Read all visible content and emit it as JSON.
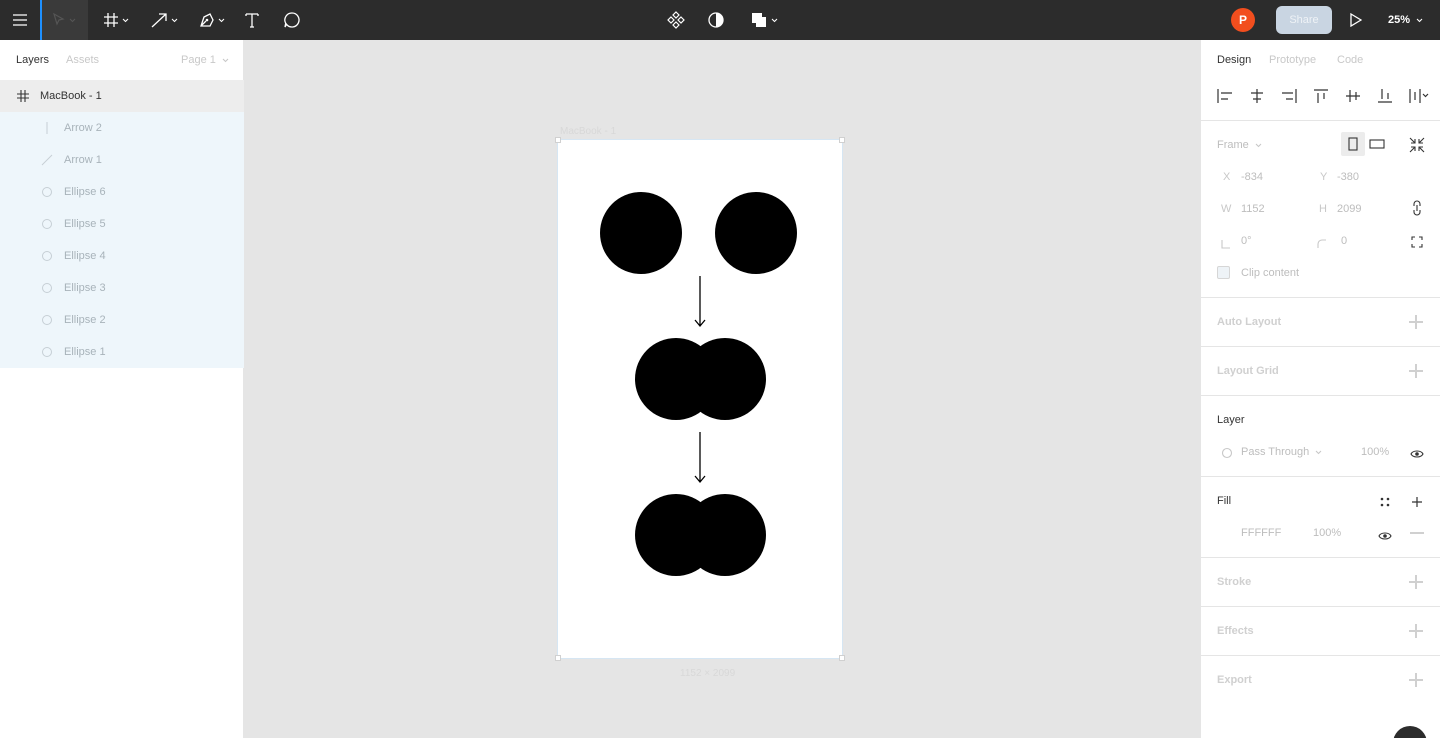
{
  "toolbar": {
    "tools": [
      {
        "name": "menu-icon"
      },
      {
        "name": "move-tool-icon"
      },
      {
        "name": "frame-tool-icon"
      },
      {
        "name": "arrow-tool-icon"
      },
      {
        "name": "pen-tool-icon"
      },
      {
        "name": "text-tool-icon"
      },
      {
        "name": "comment-tool-icon"
      }
    ],
    "center_icons": [
      "component-icon",
      "contrast-icon",
      "boolean-ops-icon"
    ],
    "avatar_initial": "P",
    "avatar_color": "#f24e1e",
    "share_label": "Share",
    "zoom_label": "25%"
  },
  "left_panel": {
    "tabs": [
      "Layers",
      "Assets"
    ],
    "page_label": "Page 1",
    "layers": [
      {
        "name": "MacBook - 1",
        "icon": "frame-icon"
      },
      {
        "name": "Arrow 2",
        "icon": "line-icon"
      },
      {
        "name": "Arrow 1",
        "icon": "line-icon"
      },
      {
        "name": "Ellipse 6",
        "icon": "ellipse-icon"
      },
      {
        "name": "Ellipse 5",
        "icon": "ellipse-icon"
      },
      {
        "name": "Ellipse 4",
        "icon": "ellipse-icon"
      },
      {
        "name": "Ellipse 3",
        "icon": "ellipse-icon"
      },
      {
        "name": "Ellipse 2",
        "icon": "ellipse-icon"
      },
      {
        "name": "Ellipse 1",
        "icon": "ellipse-icon"
      }
    ]
  },
  "canvas": {
    "frame_label": "MacBook - 1",
    "frame_dimensions": "1152 × 2099"
  },
  "right_panel": {
    "tabs": [
      "Design",
      "Prototype",
      "Code"
    ],
    "frame_label": "Frame",
    "x_label": "X",
    "x_value": "-834",
    "y_label": "Y",
    "y_value": "-380",
    "w_label": "W",
    "w_value": "1152",
    "h_label": "H",
    "h_value": "2099",
    "rotation_value": "0°",
    "radius_value": "0",
    "clip_content_label": "Clip content",
    "auto_layout_label": "Auto Layout",
    "layout_grid_label": "Layout Grid",
    "layer_title": "Layer",
    "blend_mode": "Pass Through",
    "layer_opacity": "100%",
    "fill_title": "Fill",
    "fill_hex": "FFFFFF",
    "fill_opacity": "100%",
    "stroke_label": "Stroke",
    "effects_label": "Effects",
    "export_label": "Export"
  }
}
